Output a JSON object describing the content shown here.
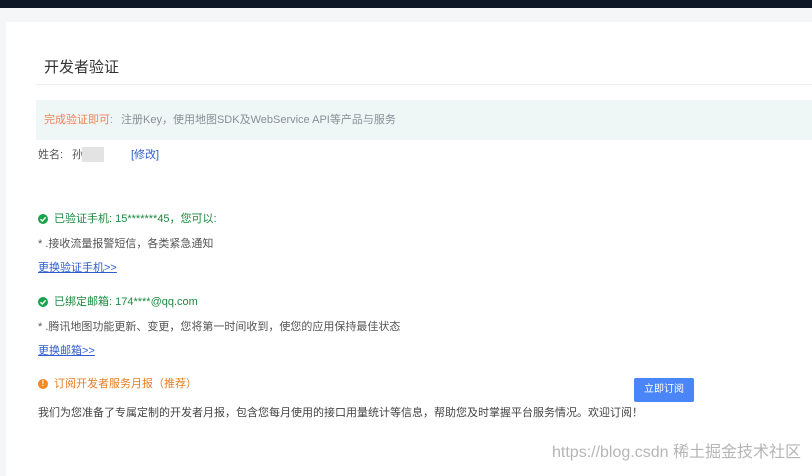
{
  "header": {
    "title": "开发者验证"
  },
  "notice": {
    "highlight": "完成验证即可:",
    "text": "注册Key，使用地图SDK及WebService API等产品与服务"
  },
  "name_row": {
    "label": "姓名:",
    "value": "孙",
    "edit_label": "[修改]"
  },
  "phone": {
    "status": "已验证手机: 15*******45，您可以:",
    "desc": "* .接收流量报警短信，各类紧急通知",
    "link": "更换验证手机>>"
  },
  "email": {
    "status": "已绑定邮箱: 174****@qq.com",
    "desc": "* .腾讯地图功能更新、变更，您将第一时间收到，使您的应用保持最佳状态",
    "link": "更换邮箱>>"
  },
  "report": {
    "title": "订阅开发者服务月报（推荐）",
    "text": "我们为您准备了专属定制的开发者月报，包含您每月使用的接口用量统计等信息，帮助您及时掌握平台服务情况。欢迎订阅！",
    "button": "立即订阅"
  },
  "watermark": "https://blog.csdn 稀土掘金技术社区",
  "icons": {
    "verified": "check-circle-icon",
    "warning": "exclamation-circle-icon"
  },
  "colors": {
    "accent": "#4a86f7",
    "success": "#1a8a3d",
    "warning": "#e67e22",
    "notice_bg": "#eef6f6"
  }
}
